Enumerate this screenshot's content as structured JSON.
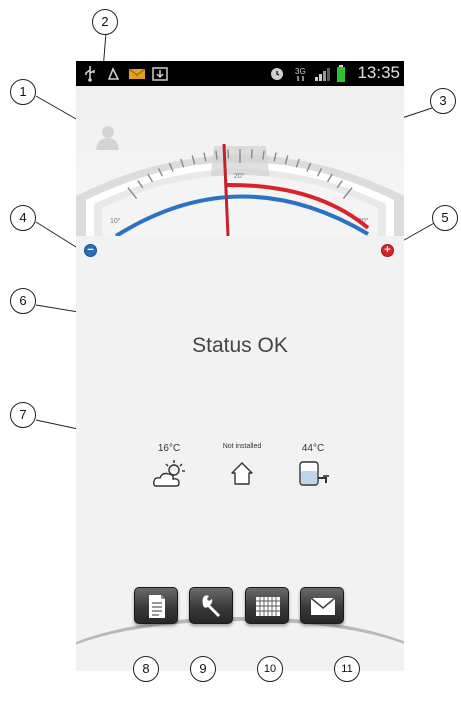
{
  "status_bar": {
    "time": "13:35",
    "icons": [
      "usb-icon",
      "recycle-icon",
      "mail-notification-icon",
      "download-icon",
      "alarm-clock-icon",
      "3g-icon",
      "signal-bars-icon",
      "battery-icon"
    ]
  },
  "gauge": {
    "tick_labels": [
      "10°",
      "20°",
      "30°"
    ],
    "scale_min": 10,
    "scale_max": 30,
    "needle_value": 20,
    "colors": {
      "cold": "#2a73c4",
      "hot": "#d8232a",
      "needle": "#c8202a"
    }
  },
  "controls": {
    "decrease_symbol": "−",
    "increase_symbol": "+"
  },
  "status": {
    "text": "Status OK"
  },
  "sensors": [
    {
      "value": "16°C",
      "icon": "weather-sun-cloud-icon"
    },
    {
      "value": "Not installed",
      "icon": "house-icon"
    },
    {
      "value": "44°C",
      "icon": "water-tank-tap-icon"
    }
  ],
  "menu_buttons": [
    {
      "icon": "document-icon"
    },
    {
      "icon": "wrench-icon"
    },
    {
      "icon": "calendar-grid-icon"
    },
    {
      "icon": "envelope-icon"
    }
  ],
  "callouts": [
    "1",
    "2",
    "3",
    "4",
    "5",
    "6",
    "7",
    "8",
    "9",
    "10",
    "11"
  ]
}
